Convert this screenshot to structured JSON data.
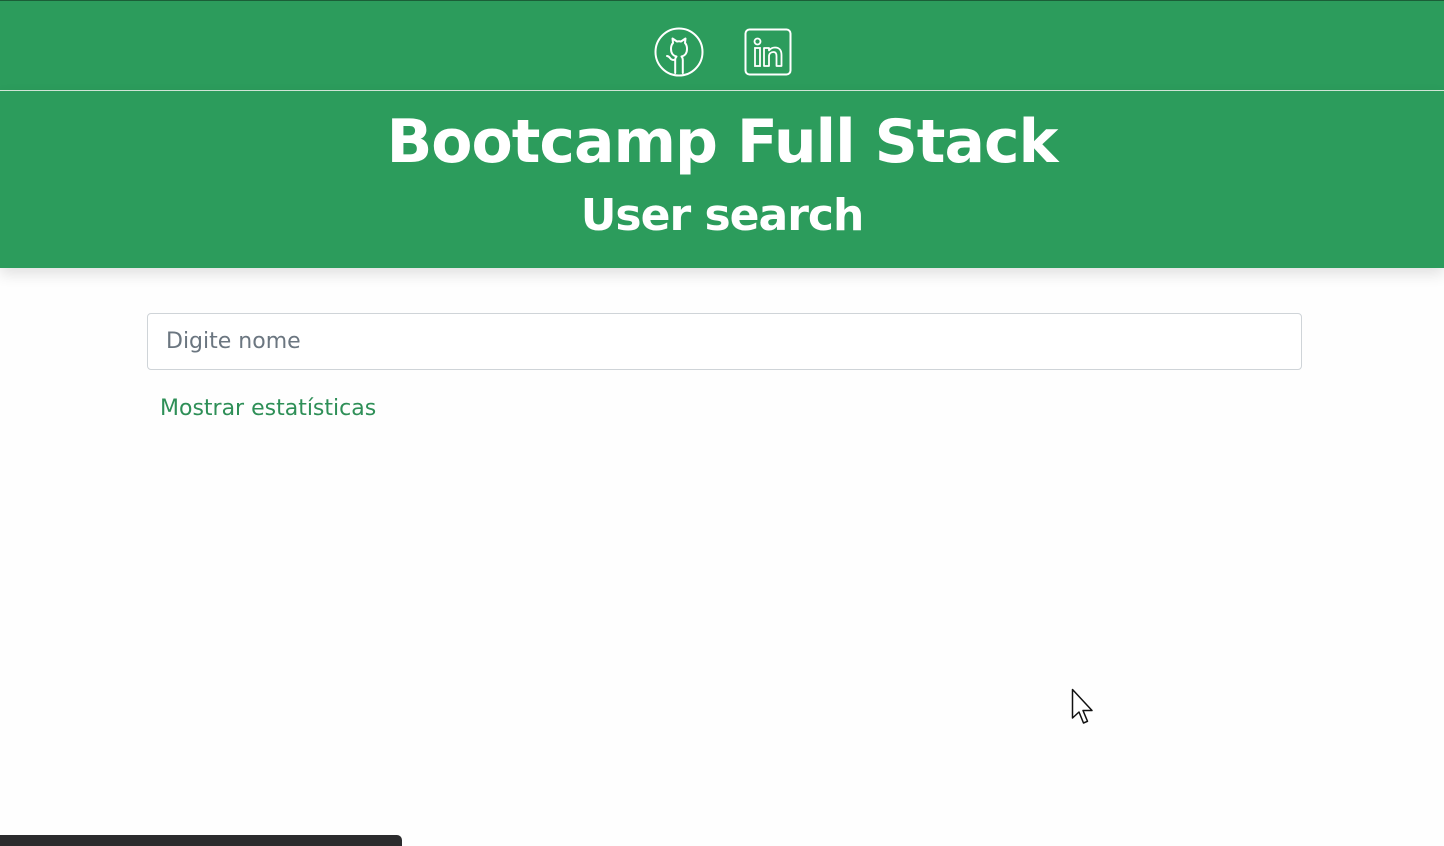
{
  "header": {
    "social_links": [
      {
        "name": "github",
        "icon": "github-icon"
      },
      {
        "name": "linkedin",
        "icon": "linkedin-icon"
      }
    ],
    "title": "Bootcamp Full Stack",
    "subtitle": "User search"
  },
  "search": {
    "placeholder": "Digite nome",
    "value": ""
  },
  "stats_link": {
    "label": "Mostrar estatísticas"
  },
  "colors": {
    "brand_green": "#2c9c5c",
    "link_green": "#2e8f57",
    "header_text": "#ffffff"
  }
}
